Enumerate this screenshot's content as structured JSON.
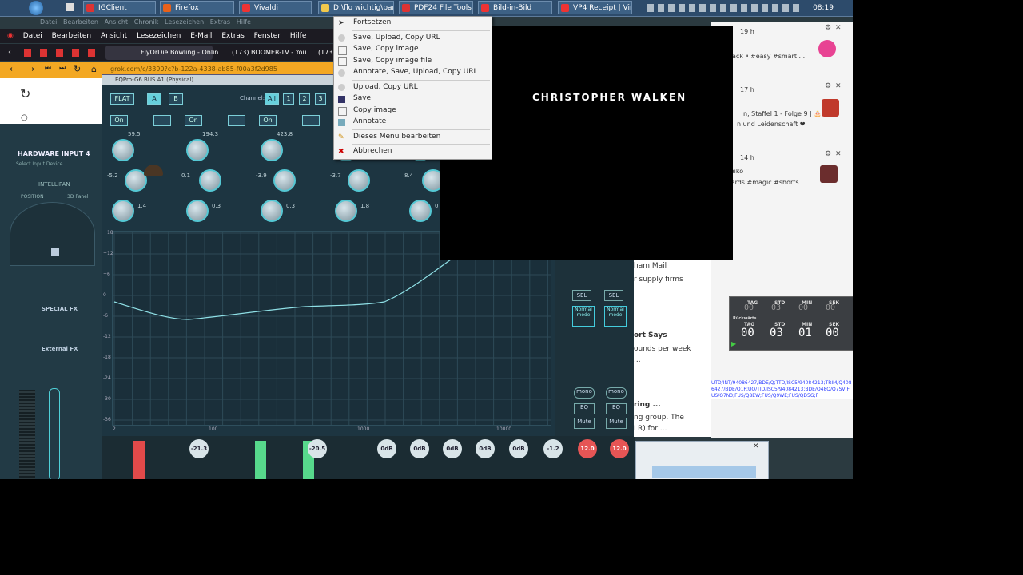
{
  "taskbar": {
    "tabs": [
      {
        "label": "IGClient",
        "color": "#d33"
      },
      {
        "label": "Firefox",
        "color": "#e8611a"
      },
      {
        "label": "Vivaldi",
        "color": "#e33"
      },
      {
        "label": "D:\\flo wichtig\\ban...",
        "color": "#f2c94c"
      },
      {
        "label": "PDF24 File Tools",
        "color": "#d33"
      },
      {
        "label": "Bild-in-Bild",
        "color": "#e33"
      },
      {
        "label": "VP4 Receipt | Virtu...",
        "color": "#e33"
      }
    ],
    "clock": "08:19"
  },
  "firefox": {
    "menu": [
      "Datei",
      "Bearbeiten",
      "Ansicht",
      "Lesezeichen",
      "E-Mail",
      "Extras",
      "Fenster",
      "Hilfe"
    ],
    "ghost_menu": [
      "Datei",
      "Bearbeiten",
      "Ansicht",
      "Chronik",
      "Lesezeichen",
      "Extras",
      "Hilfe"
    ],
    "tabs": [
      "FlyOrDie Bowling - Onlin",
      "(173) BOOMER-TV - You",
      "(173)"
    ],
    "url": "grok.com/c/3390?c?b-122a-4338-ab85-f00a3f2d985"
  },
  "eq": {
    "title": "EQPro-G6 BUS A1 (Physical)",
    "flat_label": "FLAT",
    "a_label": "A",
    "b_label": "B",
    "channel_label": "Channel:",
    "channels": [
      "All",
      "1",
      "2",
      "3"
    ],
    "on_label": "On",
    "bands": [
      {
        "freq": "59.5",
        "gain": "-5.2",
        "q": "1.4"
      },
      {
        "freq": "194.3",
        "gain": "0.1",
        "q": "0.3"
      },
      {
        "freq": "423.8",
        "gain": "-3.9",
        "q": "0.3"
      },
      {
        "freq": "",
        "gain": "-3.7",
        "q": "1.8"
      },
      {
        "freq": "",
        "gain": "8.4",
        "q": "0"
      }
    ],
    "hz_label": "Hz",
    "db_label": "db",
    "q_label": "Q",
    "y_ticks": [
      "+18",
      "+12",
      "+6",
      "0",
      "-6",
      "-12",
      "-18",
      "-24",
      "-30",
      "-36"
    ],
    "x_ticks": [
      "2",
      "100",
      "1000",
      "10000"
    ]
  },
  "context_menu": {
    "items": [
      {
        "label": "Fortsetzen",
        "icon": "cursor-icon"
      },
      {
        "label": "Save, Upload, Copy URL",
        "icon": "cloud-icon"
      },
      {
        "label": "Save, Copy image",
        "icon": "page-icon"
      },
      {
        "label": "Save, Copy image file",
        "icon": "page-icon"
      },
      {
        "label": "Annotate, Save, Upload, Copy URL",
        "icon": "cloud-icon"
      },
      {
        "label": "Upload, Copy URL",
        "icon": "cloud-icon"
      },
      {
        "label": "Save",
        "icon": "floppy-icon"
      },
      {
        "label": "Copy image",
        "icon": "page-icon"
      },
      {
        "label": "Annotate",
        "icon": "annotate-icon"
      },
      {
        "label": "Dieses Menü bearbeiten",
        "icon": "pencil-icon"
      },
      {
        "label": "Abbrechen",
        "icon": "close-icon"
      }
    ]
  },
  "video": {
    "name": "CHRISTOPHER WALKEN"
  },
  "notifications": [
    {
      "time": "19 h",
      "text": "ack ⏸ #easy #smart ...",
      "color": "#e84393"
    },
    {
      "time": "17 h",
      "text": "n, Staffel 1 - Folge 9 | 🎂",
      "text2": "n und Leidenschaft ❤",
      "color": "#c0392b"
    },
    {
      "time": "14 h",
      "text": "t Heiko",
      "text2": "lliards #magic #shorts",
      "color": "#6b2d2d"
    }
  ],
  "article": {
    "lines": [
      "ham Mail",
      "r supply firms",
      "ort Says",
      "ounds per week",
      "...",
      "ring ...",
      "ng group. The",
      "LR) for ..."
    ]
  },
  "timer": {
    "top_labels": [
      "TAG",
      "STD",
      "MIN",
      "SEK"
    ],
    "top_values": [
      "00",
      "03",
      "00",
      "00"
    ],
    "title": "Rückwärts",
    "labels": [
      "TAG",
      "STD",
      "MIN",
      "SEK"
    ],
    "values": [
      "00",
      "03",
      "01",
      "00"
    ]
  },
  "mixer": {
    "faders": [
      "-21.3",
      "-20.5",
      "0dB",
      "0dB",
      "0dB",
      "0dB",
      "0dB",
      "-1.2",
      "12.0",
      "12.0"
    ],
    "hardware_label": "HARDWARE INPUT 4",
    "select_label": "Select Input Device",
    "intellipan_label": "INTELLIPAN",
    "position_label": "POSITION",
    "panel_label": "3D Panel",
    "special_fx_label": "SPECIAL FX",
    "external_fx_label": "External FX",
    "normal_mode_label": "Normal mode",
    "sel_label": "SEL",
    "mono_label": "mono",
    "eq_label": "EQ",
    "mute_label": "Mute"
  },
  "links_text": "UTD/INT/94086427/BDE/Q;TTD/ISC5/94084213;TRIM/Q4086427/BDE/Q1P;UQ/TID/ISC5/94084213;BDE/Q48Q/Q7SV;FUS/Q7N3;FUS/Q8EW;FUS/Q9WE;FUS/QD5G;F"
}
